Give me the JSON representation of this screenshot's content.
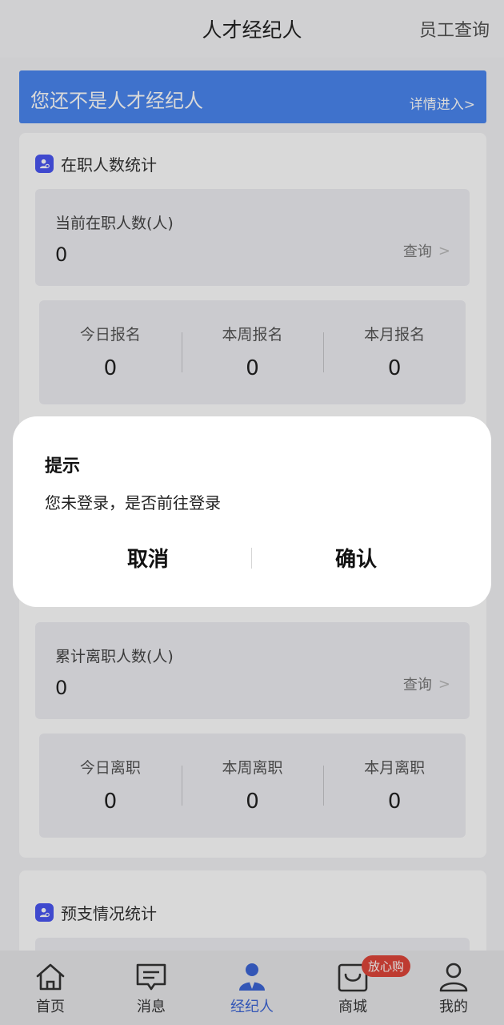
{
  "header": {
    "title": "人才经纪人",
    "action": "员工查询"
  },
  "banner": {
    "title": "您还不是人才经纪人",
    "link": "详情进入>"
  },
  "section_employed": {
    "title": "在职人数统计",
    "current": {
      "label": "当前在职人数(人)",
      "value": "0",
      "query": "查询"
    },
    "stats": [
      {
        "label": "今日报名",
        "value": "0"
      },
      {
        "label": "本周报名",
        "value": "0"
      },
      {
        "label": "本月报名",
        "value": "0"
      }
    ]
  },
  "section_resigned": {
    "total": {
      "label": "累计离职人数(人)",
      "value": "0",
      "query": "查询"
    },
    "stats": [
      {
        "label": "今日离职",
        "value": "0"
      },
      {
        "label": "本周离职",
        "value": "0"
      },
      {
        "label": "本月离职",
        "value": "0"
      }
    ]
  },
  "section_advance": {
    "title": "预支情况统计"
  },
  "dialog": {
    "title": "提示",
    "message": "您未登录，是否前往登录",
    "cancel": "取消",
    "confirm": "确认"
  },
  "tabbar": {
    "items": [
      {
        "label": "首页",
        "icon": "home-icon"
      },
      {
        "label": "消息",
        "icon": "message-icon"
      },
      {
        "label": "经纪人",
        "icon": "agent-icon"
      },
      {
        "label": "商城",
        "icon": "shop-icon",
        "badge": "放心购"
      },
      {
        "label": "我的",
        "icon": "profile-icon"
      }
    ],
    "active_color": "#3d66d6"
  },
  "colors": {
    "banner": "#4a86f0",
    "section_icon": "#4a56f2",
    "badge": "#e0463a"
  }
}
